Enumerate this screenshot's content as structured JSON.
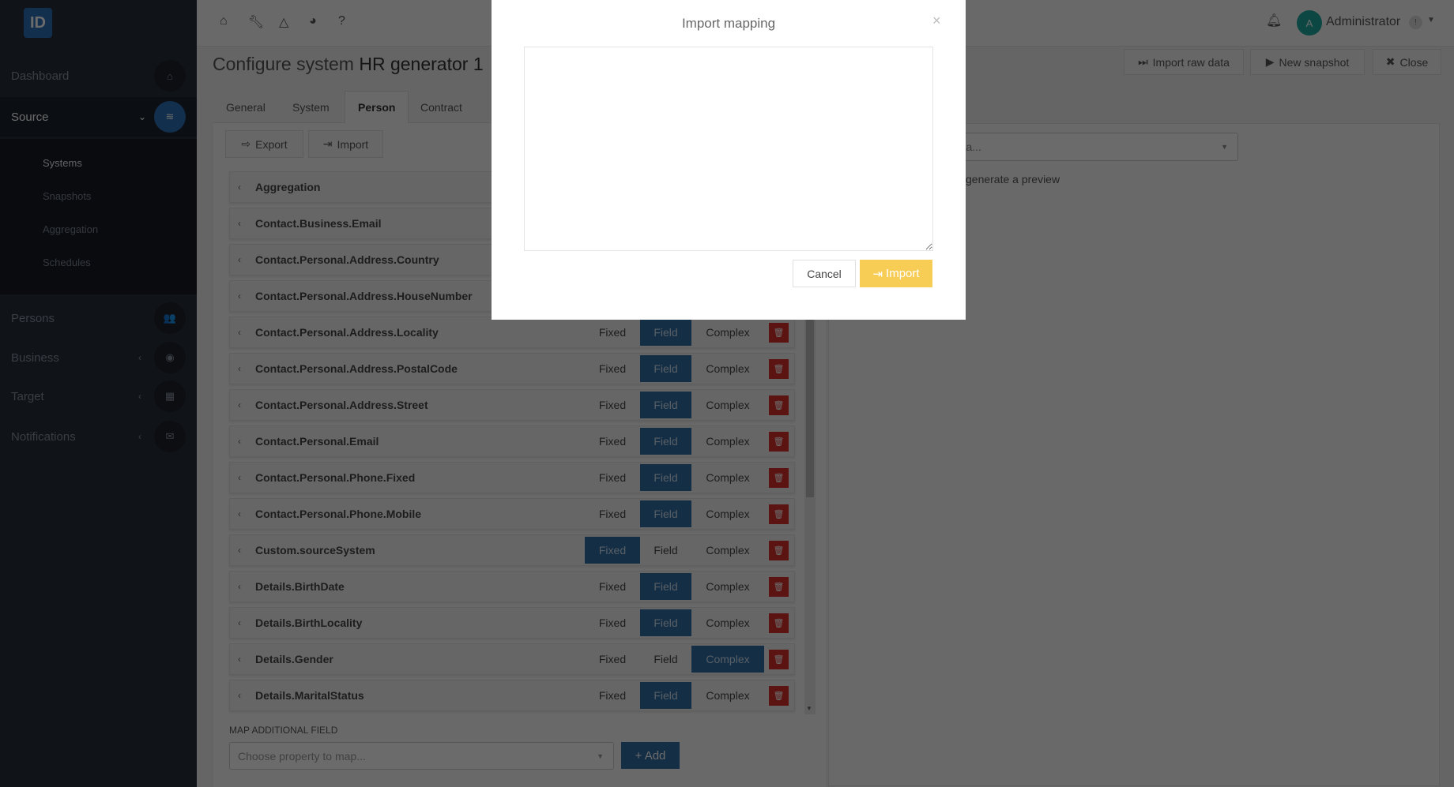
{
  "sidebar": {
    "logo": "ID",
    "items": [
      {
        "label": "Dashboard",
        "icon": "home-icon",
        "glyph": "⌂"
      },
      {
        "label": "Source",
        "icon": "layers-icon",
        "glyph": "≋",
        "chevron": "⌄"
      },
      {
        "label": "Persons",
        "icon": "users-icon",
        "glyph": "👥"
      },
      {
        "label": "Business",
        "icon": "globe-icon",
        "glyph": "◉",
        "chevron": "‹"
      },
      {
        "label": "Target",
        "icon": "grid-icon",
        "glyph": "▦",
        "chevron": "‹"
      },
      {
        "label": "Notifications",
        "icon": "envelope-icon",
        "glyph": "✉",
        "chevron": "‹"
      }
    ],
    "sub": [
      "Systems",
      "Snapshots",
      "Aggregation",
      "Schedules"
    ]
  },
  "topbar": {
    "icons": [
      "home-icon",
      "wrench-icon",
      "network-icon",
      "pie-chart-icon",
      "help-icon"
    ],
    "user": "Administrator",
    "avatar": "A",
    "badge": "!"
  },
  "page": {
    "title_prefix": "Configure system",
    "title_name": "HR generator 1"
  },
  "actions": {
    "import_raw": "Import raw data",
    "new_snapshot": "New snapshot",
    "close": "Close"
  },
  "tabs": [
    "General",
    "System",
    "Person",
    "Contract"
  ],
  "toolbar": {
    "export": "Export",
    "import": "Import"
  },
  "modes": [
    "Fixed",
    "Field",
    "Complex"
  ],
  "rows": [
    {
      "name": "Aggregation",
      "mode": null
    },
    {
      "name": "Contact.Business.Email",
      "mode": null
    },
    {
      "name": "Contact.Personal.Address.Country",
      "mode": null
    },
    {
      "name": "Contact.Personal.Address.HouseNumber",
      "mode": null
    },
    {
      "name": "Contact.Personal.Address.Locality",
      "mode": "Field"
    },
    {
      "name": "Contact.Personal.Address.PostalCode",
      "mode": "Field"
    },
    {
      "name": "Contact.Personal.Address.Street",
      "mode": "Field"
    },
    {
      "name": "Contact.Personal.Email",
      "mode": "Field"
    },
    {
      "name": "Contact.Personal.Phone.Fixed",
      "mode": "Field"
    },
    {
      "name": "Contact.Personal.Phone.Mobile",
      "mode": "Field"
    },
    {
      "name": "Custom.sourceSystem",
      "mode": "Fixed"
    },
    {
      "name": "Details.BirthDate",
      "mode": "Field"
    },
    {
      "name": "Details.BirthLocality",
      "mode": "Field"
    },
    {
      "name": "Details.Gender",
      "mode": "Complex"
    },
    {
      "name": "Details.MaritalStatus",
      "mode": "Field"
    }
  ],
  "map_additional": {
    "label": "MAP ADDITIONAL FIELD",
    "placeholder": "Choose property to map...",
    "add": "+ Add"
  },
  "preview": {
    "select_placeholder": "e imported data...",
    "hint": "generate a preview"
  },
  "modal": {
    "title": "Import mapping",
    "close": "×",
    "textarea_value": "",
    "cancel": "Cancel",
    "import": "Import"
  },
  "colors": {
    "accent": "#2f6ea5",
    "danger": "#d9302c",
    "warning": "#f7cd55",
    "sidebar": "#262d3a"
  }
}
